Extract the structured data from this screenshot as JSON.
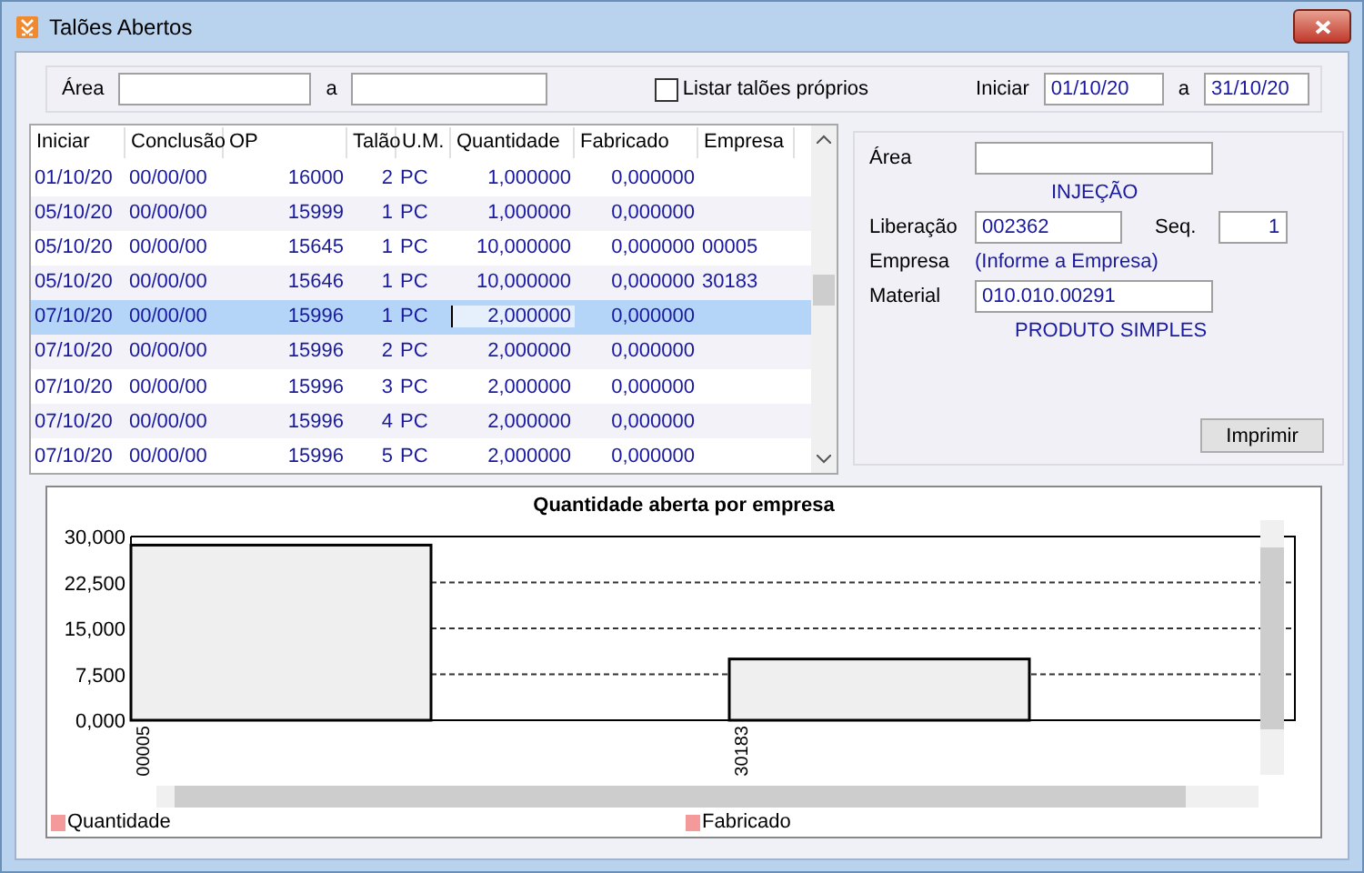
{
  "window": {
    "title": "Talões Abertos"
  },
  "filter": {
    "area": {
      "label": "Área",
      "separator": "a"
    },
    "own_only": {
      "label": "Listar talões próprios",
      "checked": false
    },
    "start": {
      "label": "Iniciar",
      "from": "01/10/20",
      "separator": "a",
      "to": "31/10/20"
    }
  },
  "table": {
    "columns": [
      "Iniciar",
      "Conclusão",
      "OP",
      "Talão",
      "U.M.",
      "Quantidade",
      "Fabricado",
      "Empresa"
    ],
    "rows": [
      {
        "cells": [
          "01/10/20",
          "00/00/00",
          "16000",
          "2",
          "PC",
          "1,000000",
          "0,000000",
          ""
        ],
        "selected": false
      },
      {
        "cells": [
          "05/10/20",
          "00/00/00",
          "15999",
          "1",
          "PC",
          "1,000000",
          "0,000000",
          ""
        ],
        "selected": false
      },
      {
        "cells": [
          "05/10/20",
          "00/00/00",
          "15645",
          "1",
          "PC",
          "10,000000",
          "0,000000",
          "00005"
        ],
        "selected": false
      },
      {
        "cells": [
          "05/10/20",
          "00/00/00",
          "15646",
          "1",
          "PC",
          "10,000000",
          "0,000000",
          "30183"
        ],
        "selected": false
      },
      {
        "cells": [
          "07/10/20",
          "00/00/00",
          "15996",
          "1",
          "PC",
          "2,000000",
          "0,000000",
          ""
        ],
        "selected": true
      },
      {
        "cells": [
          "07/10/20",
          "00/00/00",
          "15996",
          "2",
          "PC",
          "2,000000",
          "0,000000",
          ""
        ],
        "selected": false
      },
      {
        "cells": [
          "07/10/20",
          "00/00/00",
          "15996",
          "3",
          "PC",
          "2,000000",
          "0,000000",
          ""
        ],
        "selected": false
      },
      {
        "cells": [
          "07/10/20",
          "00/00/00",
          "15996",
          "4",
          "PC",
          "2,000000",
          "0,000000",
          ""
        ],
        "selected": false
      },
      {
        "cells": [
          "07/10/20",
          "00/00/00",
          "15996",
          "5",
          "PC",
          "2,000000",
          "0,000000",
          ""
        ],
        "selected": false
      }
    ]
  },
  "detail": {
    "area_label": "Área",
    "area_name": "INJEÇÃO",
    "release_label": "Liberação",
    "release": "002362",
    "seq_label": "Seq.",
    "seq": "1",
    "company_label": "Empresa",
    "company": "(Informe a Empresa)",
    "material_label": "Material",
    "material": "010.010.00291",
    "material_name": "PRODUTO SIMPLES",
    "print_button": "Imprimir"
  },
  "chart": {
    "chart_data": {
      "type": "bar",
      "title": "Quantidade aberta por empresa",
      "categories": [
        "00005",
        "30183"
      ],
      "series": [
        {
          "name": "Quantidade",
          "color": "#efefef",
          "values": [
            28.6,
            10
          ]
        },
        {
          "name": "Fabricado",
          "values": [
            0,
            0
          ]
        }
      ],
      "grid": true,
      "ylim": [
        0,
        30
      ],
      "yticks": [
        {
          "value": 0,
          "label": "0,000"
        },
        {
          "value": 7.5,
          "label": "7,500"
        },
        {
          "value": 15,
          "label": "15,000"
        },
        {
          "value": 22.5,
          "label": "22,500"
        },
        {
          "value": 30,
          "label": "30,000"
        }
      ]
    },
    "legend": [
      {
        "color": "#f49a9a"
      },
      {
        "color": "#f49a9a"
      }
    ]
  }
}
